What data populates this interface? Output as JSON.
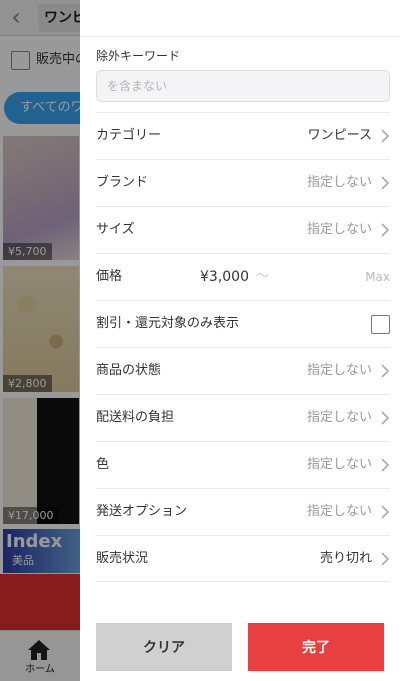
{
  "background": {
    "header_title": "ワンピース",
    "checkbox_label": "販売中のみ表示",
    "pill_label": "すべてのワンピース",
    "items": [
      {
        "price": "¥5,700"
      },
      {
        "price": "¥2,800"
      },
      {
        "price": "¥17,000"
      }
    ],
    "ad_title": "Index",
    "ad_sub": "美品",
    "tab_home_label": "ホーム"
  },
  "filter": {
    "keyword": {
      "label": "除外キーワード",
      "placeholder": "を含まない",
      "value": ""
    },
    "rows": [
      {
        "label": "カテゴリー",
        "value": "ワンピース",
        "strong": true
      },
      {
        "label": "ブランド",
        "value": "指定しない"
      },
      {
        "label": "サイズ",
        "value": "指定しない"
      },
      {
        "label": "価格",
        "min": "¥3,000",
        "tilde": "〜",
        "max": "Max"
      },
      {
        "label": "割引・還元対象のみ表示",
        "checked": false
      },
      {
        "label": "商品の状態",
        "value": "指定しない"
      },
      {
        "label": "配送料の負担",
        "value": "指定しない"
      },
      {
        "label": "色",
        "value": "指定しない"
      },
      {
        "label": "発送オプション",
        "value": "指定しない"
      },
      {
        "label": "販売状況",
        "value": "売り切れ",
        "strong": true
      }
    ],
    "buttons": {
      "clear": "クリア",
      "done": "完了"
    }
  },
  "colors": {
    "accent_red": "#e84040",
    "clear_gray": "#d0d0d0",
    "pill_blue": "#3aa3f0"
  },
  "icons": {
    "back": "chevron-left-icon",
    "row": "chevron-right-icon",
    "home": "home-icon"
  }
}
